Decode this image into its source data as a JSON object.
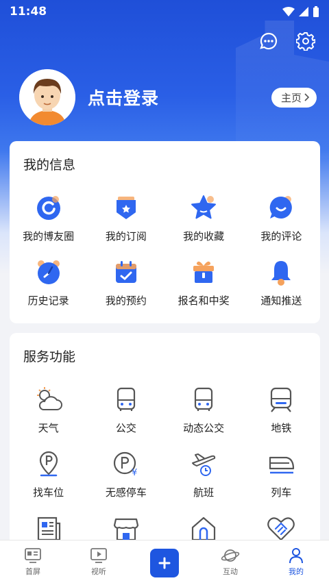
{
  "status": {
    "time": "11:48"
  },
  "profile": {
    "login_text": "点击登录",
    "home_label": "主页"
  },
  "info_card": {
    "title": "我的信息",
    "items": [
      {
        "label": "我的博友圈",
        "icon": "ring-icon"
      },
      {
        "label": "我的订阅",
        "icon": "subscribe-icon"
      },
      {
        "label": "我的收藏",
        "icon": "star-icon"
      },
      {
        "label": "我的评论",
        "icon": "comment-icon"
      },
      {
        "label": "历史记录",
        "icon": "clock-icon"
      },
      {
        "label": "我的预约",
        "icon": "calendar-icon"
      },
      {
        "label": "报名和中奖",
        "icon": "gift-icon"
      },
      {
        "label": "通知推送",
        "icon": "bell-icon"
      }
    ]
  },
  "service_card": {
    "title": "服务功能",
    "items": [
      {
        "label": "天气",
        "icon": "weather-icon"
      },
      {
        "label": "公交",
        "icon": "bus-icon"
      },
      {
        "label": "动态公交",
        "icon": "live-bus-icon"
      },
      {
        "label": "地铁",
        "icon": "subway-icon"
      },
      {
        "label": "找车位",
        "icon": "parking-icon"
      },
      {
        "label": "无感停车",
        "icon": "paid-parking-icon"
      },
      {
        "label": "航班",
        "icon": "flight-icon"
      },
      {
        "label": "列车",
        "icon": "train-icon"
      },
      {
        "label": "",
        "icon": "newspaper-icon"
      },
      {
        "label": "",
        "icon": "store-icon"
      },
      {
        "label": "",
        "icon": "house-icon"
      },
      {
        "label": "",
        "icon": "handshake-heart-icon"
      }
    ]
  },
  "tabbar": {
    "tabs": [
      {
        "label": "首屏",
        "icon": "home-screen-icon"
      },
      {
        "label": "视听",
        "icon": "video-icon"
      },
      {
        "label": "",
        "icon": "plus-icon"
      },
      {
        "label": "互动",
        "icon": "planet-icon"
      },
      {
        "label": "我的",
        "icon": "person-icon"
      }
    ],
    "active": "我的"
  },
  "colors": {
    "primary": "#1e56e0",
    "icon_blue": "#2f67f0",
    "accent_orange": "#f5a25d"
  }
}
